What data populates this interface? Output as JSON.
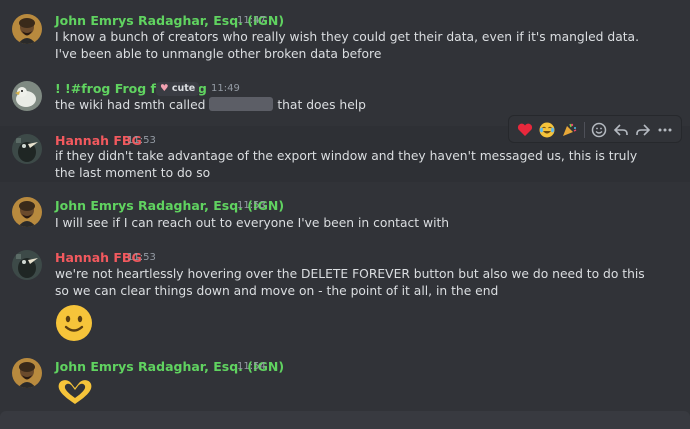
{
  "colors": {
    "green": "#60d360",
    "red": "#f2595e",
    "background": "#313338"
  },
  "messages": [
    {
      "author": "John Emrys Radaghar, Esq. (IGN)",
      "time": "11:47",
      "text": "I know a bunch of creators who really wish they could get their data, even if it's mangled data. I've been able to unmangle other broken data before"
    },
    {
      "author": "! !#frog Frog fan frog",
      "tag": "cute",
      "time": "11:49",
      "text_before": "the wiki had smth called",
      "text_after": "that does help"
    },
    {
      "author": "Hannah FBG",
      "time": "11:53",
      "text": "if they didn't take advantage of the export window and they haven't messaged us, this is truly the last moment to do so"
    },
    {
      "author": "John Emrys Radaghar, Esq. (IGN)",
      "time": "11:53",
      "text": "I will see if I can reach out to everyone I've been in contact with"
    },
    {
      "author": "Hannah FBG",
      "time": "11:53",
      "text": "we're not heartlessly hovering over the DELETE FOREVER button but also we do need to do this so we can clear things down and move on - the point of it all, in the end"
    },
    {
      "author": "John Emrys Radaghar, Esq. (IGN)",
      "time": "11:54"
    }
  ],
  "toolbar": {
    "reactions": [
      "heart",
      "joy",
      "party-popper"
    ],
    "actions": [
      "add-reaction-icon",
      "reply-icon",
      "forward-icon",
      "more-icon"
    ]
  }
}
